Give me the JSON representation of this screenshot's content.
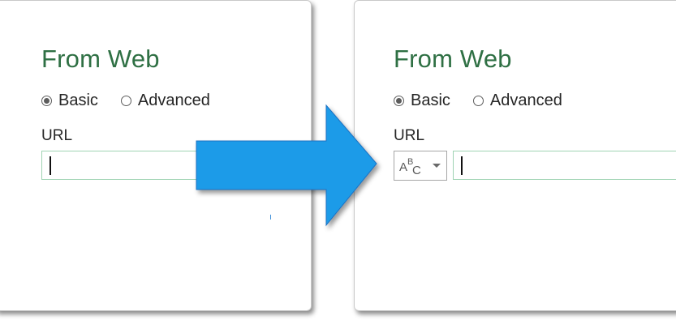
{
  "left_panel": {
    "title": "From Web",
    "radio_basic": "Basic",
    "radio_advanced": "Advanced",
    "selected": "Basic",
    "url_label": "URL",
    "url_value": ""
  },
  "right_panel": {
    "title": "From Web",
    "radio_basic": "Basic",
    "radio_advanced": "Advanced",
    "selected": "Basic",
    "url_label": "URL",
    "type_dropdown": {
      "icon": "abc-text-type-icon",
      "a": "A",
      "b": "B",
      "c": "C"
    },
    "url_value": ""
  },
  "colors": {
    "title": "#2f7044",
    "input_border": "#9fd3b3",
    "arrow_fill": "#1e9be8",
    "arrow_stroke": "#1a72c4"
  }
}
